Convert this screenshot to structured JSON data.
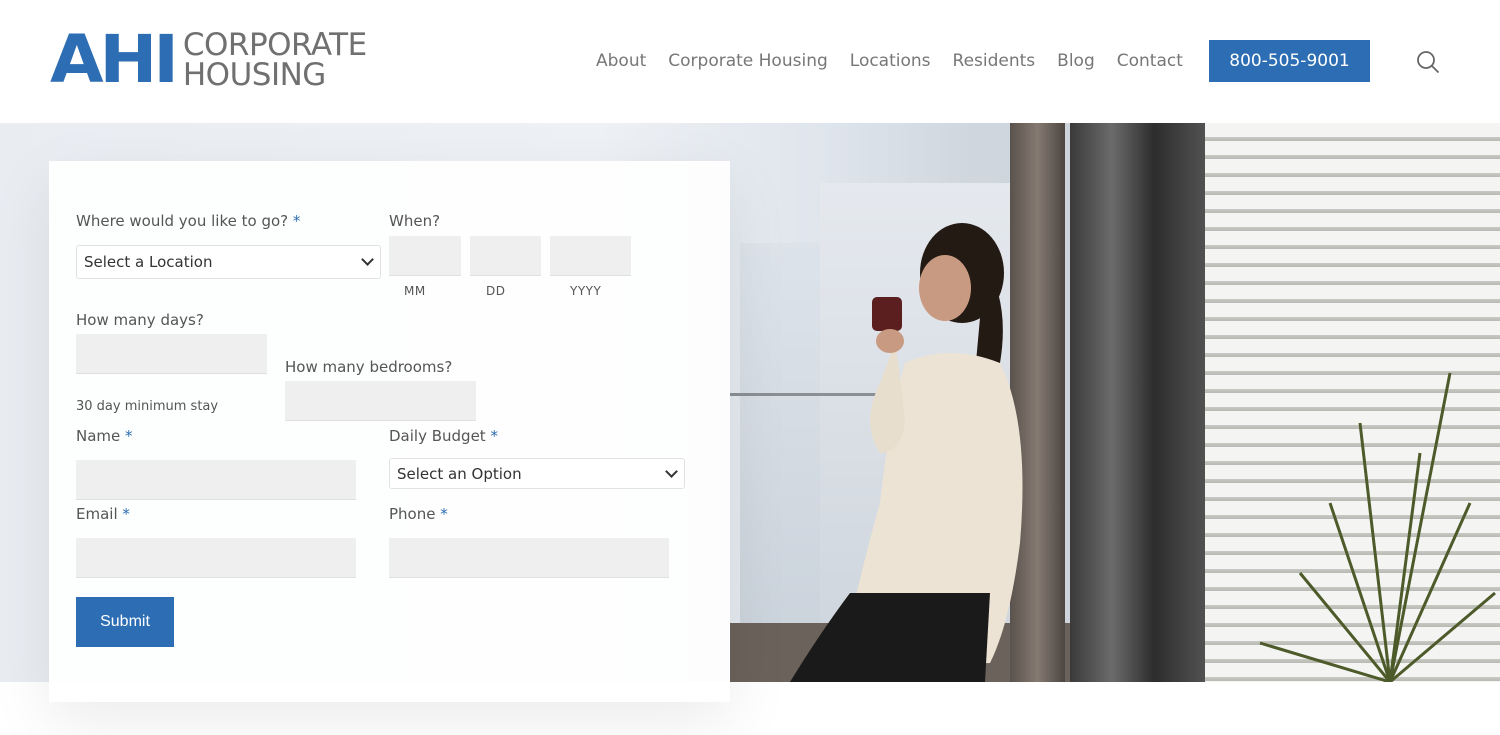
{
  "brand": {
    "mark": "AHI",
    "line1": "CORPORATE",
    "line2": "HOUSING"
  },
  "nav": {
    "items": [
      "About",
      "Corporate Housing",
      "Locations",
      "Residents",
      "Blog",
      "Contact"
    ],
    "phone": "800-505-9001"
  },
  "form": {
    "where_label": "Where would you like to go?",
    "required_mark": "*",
    "location_selected": "Select a Location",
    "when_label": "When?",
    "mm": "MM",
    "dd": "DD",
    "yyyy": "YYYY",
    "days_label": "How many days?",
    "days_hint": "30 day minimum stay",
    "bedrooms_label": "How many bedrooms?",
    "name_label": "Name",
    "budget_label": "Daily Budget",
    "budget_selected": "Select an Option",
    "email_label": "Email",
    "phone_label": "Phone",
    "submit": "Submit"
  },
  "colors": {
    "accent": "#2c6db3",
    "text": "#555555"
  }
}
